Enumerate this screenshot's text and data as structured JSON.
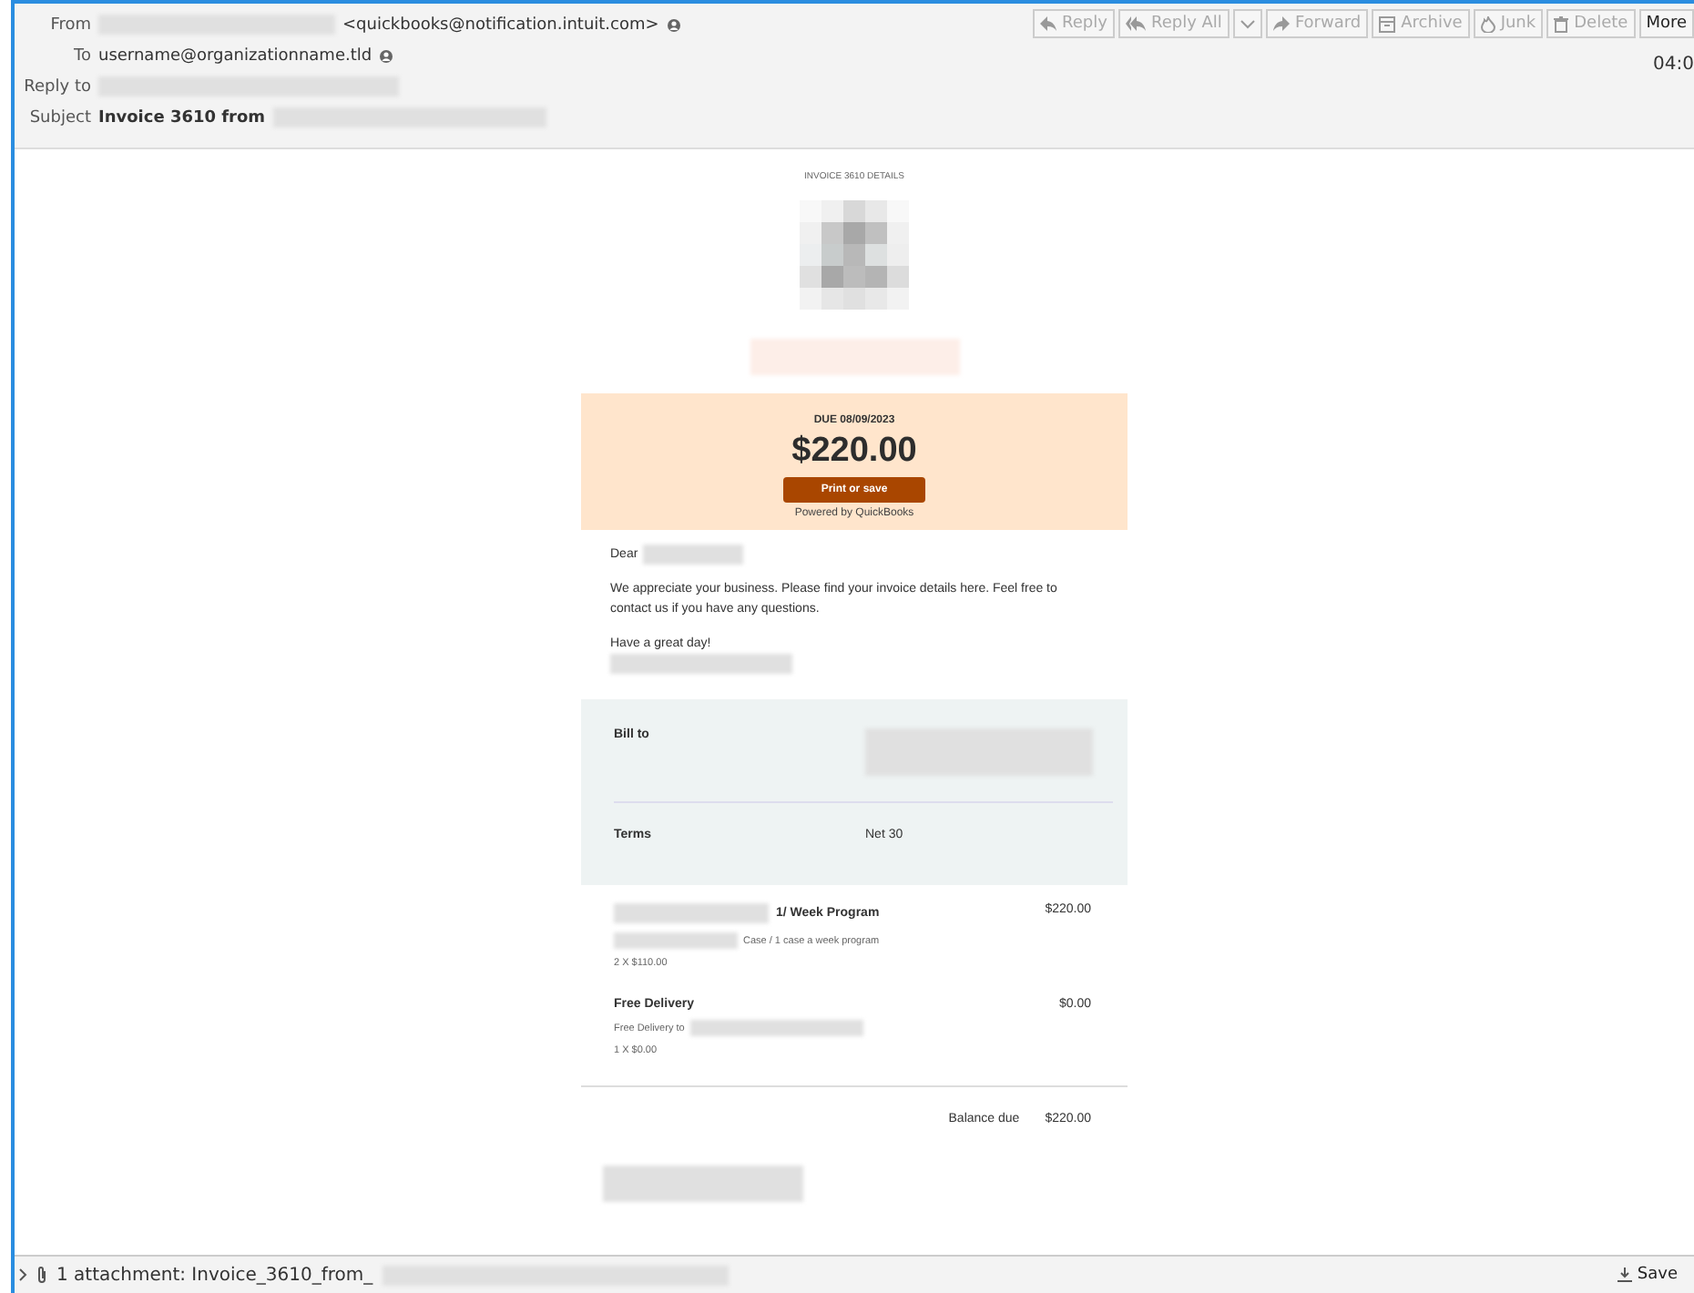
{
  "header": {
    "fields": [
      {
        "label": "From",
        "value": "<quickbooks@notification.intuit.com>",
        "kind": "sender"
      },
      {
        "label": "To",
        "value": "username@organizationname.tld",
        "kind": "recipient"
      },
      {
        "label": "Reply to",
        "kind": "replyto"
      },
      {
        "label": "Subject",
        "value": "Invoice 3610 from",
        "kind": "subject"
      }
    ],
    "buttons": [
      {
        "label": "Reply",
        "kind": "reply",
        "disabled": true
      },
      {
        "label": "Reply All",
        "kind": "replyall",
        "disabled": true
      },
      {
        "kind": "caret"
      },
      {
        "label": "Forward",
        "kind": "forward",
        "disabled": true
      },
      {
        "label": "Archive",
        "kind": "archive",
        "disabled": true
      },
      {
        "label": "Junk",
        "kind": "junk",
        "disabled": true
      },
      {
        "label": "Delete",
        "kind": "delete",
        "disabled": true
      },
      {
        "label": "More",
        "kind": "none",
        "disabled": false
      }
    ],
    "time": "04:0"
  },
  "invoice": {
    "heading": "INVOICE 3610 DETAILS",
    "due": "DUE 08/09/2023",
    "amount": "$220.00",
    "print_button": "Print or save",
    "powered_by": "Powered by QuickBooks",
    "greeting": "Dear",
    "message": "We appreciate your business. Please find your invoice details here. Feel free to contact us if you have any questions.",
    "closing": "Have a great day!",
    "details": [
      {
        "label": "Bill to"
      },
      {
        "label": "Terms",
        "value": "Net 30"
      }
    ],
    "items": [
      {
        "name": "1/ Week Program",
        "amount": "$220.00",
        "description": "Case / 1 case a week program",
        "quantity": "2 X $110.00"
      },
      {
        "name": "Free Delivery",
        "amount": "$0.00",
        "description": "Free Delivery to",
        "quantity": "1 X $0.00"
      }
    ],
    "balance_label": "Balance due",
    "balance": "$220.00"
  },
  "attachments": {
    "summary": "1 attachment: Invoice_3610_from_",
    "save": "Save"
  }
}
